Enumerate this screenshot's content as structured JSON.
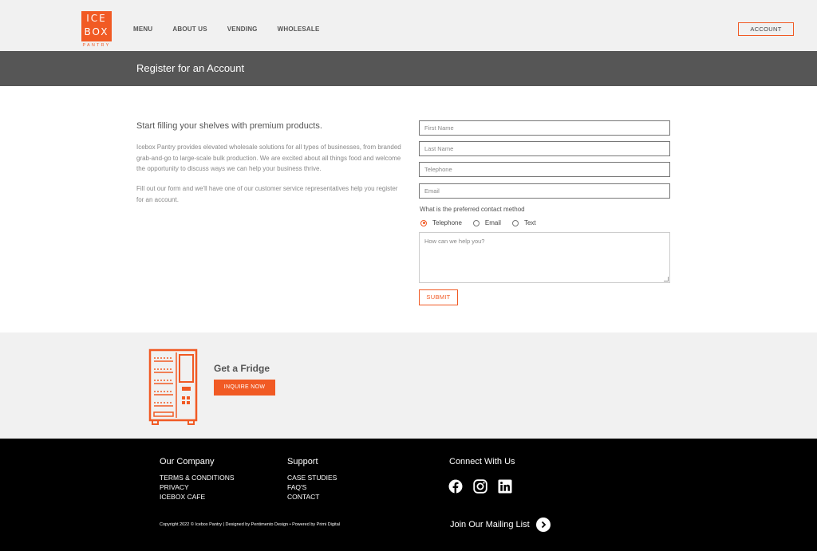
{
  "brand": {
    "logo_line1": "ICE",
    "logo_line2": "BOX",
    "logo_sub": "PANTRY",
    "accent": "#f15a24"
  },
  "nav": {
    "items": [
      "MENU",
      "ABOUT US",
      "VENDING",
      "WHOLESALE"
    ],
    "account_label": "ACCOUNT"
  },
  "page": {
    "title": "Register for an Account"
  },
  "intro": {
    "heading": "Start filling your shelves with premium products.",
    "para1": "Icebox Pantry provides elevated wholesale solutions for all types of businesses, from branded grab-and-go to large-scale bulk production. We are excited about all things food and welcome the opportunity to discuss ways we can help your business thrive.",
    "para2": "Fill out our form and we'll have one of our customer service representatives help you register for an account."
  },
  "form": {
    "first_name_placeholder": "First Name",
    "last_name_placeholder": "Last Name",
    "telephone_placeholder": "Telephone",
    "email_placeholder": "Email",
    "contact_question": "What is the preferred contact method",
    "contact_options": [
      "Telephone",
      "Email",
      "Text"
    ],
    "contact_selected": "Telephone",
    "message_placeholder": "How can we help you?",
    "submit_label": "SUBMIT"
  },
  "fridge": {
    "title": "Get a Fridge",
    "button_label": "INQUIRE NOW",
    "icon": "vending-machine-icon"
  },
  "footer": {
    "company": {
      "heading": "Our Company",
      "links": [
        "TERMS & CONDITIONS",
        "PRIVACY",
        "ICEBOX CAFE"
      ]
    },
    "support": {
      "heading": "Support",
      "links": [
        "CASE STUDIES",
        "FAQ'S",
        "CONTACT"
      ]
    },
    "connect": {
      "heading": "Connect With Us",
      "icons": [
        "facebook-icon",
        "instagram-icon",
        "linkedin-icon"
      ]
    },
    "copyright": "Copyright 2022 © Icebox Pantry | Designed by Pentimento Design • Powered by Primi Digital",
    "mailing_label": "Join Our Mailing List"
  }
}
